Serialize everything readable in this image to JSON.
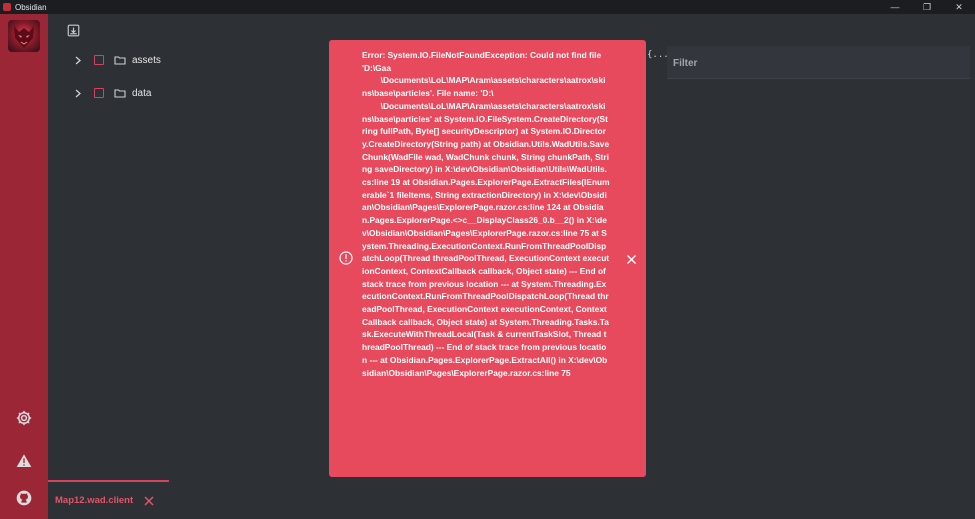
{
  "app": {
    "title": "Obsidian"
  },
  "window_controls": {
    "minimize": "—",
    "maximize": "❐",
    "close": "✕"
  },
  "tree": {
    "items": [
      {
        "label": "assets"
      },
      {
        "label": "data"
      }
    ]
  },
  "filter": {
    "placeholder": "Filter",
    "value": ""
  },
  "json_icon": "{...}",
  "tab": {
    "label": "Map12.wad.client"
  },
  "error": {
    "message": "Error: System.IO.FileNotFoundException: Could not find file 'D:\\Gaa\n        \\Documents\\LoL\\MAP\\Aram\\assets\\characters\\aatrox\\skins\\base\\particles'. File name: 'D:\\\n        \\Documents\\LoL\\MAP\\Aram\\assets\\characters\\aatrox\\skins\\base\\particles' at System.IO.FileSystem.CreateDirectory(String fullPath, Byte[] securityDescriptor) at System.IO.Directory.CreateDirectory(String path) at Obsidian.Utils.WadUtils.SaveChunk(WadFile wad, WadChunk chunk, String chunkPath, String saveDirectory) in X:\\dev\\Obsidian\\Obsidian\\Utils\\WadUtils.cs:line 19 at Obsidian.Pages.ExplorerPage.ExtractFiles(IEnumerable`1 fileItems, String extractionDirectory) in X:\\dev\\Obsidian\\Obsidian\\Pages\\ExplorerPage.razor.cs:line 124 at Obsidian.Pages.ExplorerPage.<>c__DisplayClass26_0.b__2() in X:\\dev\\Obsidian\\Obsidian\\Pages\\ExplorerPage.razor.cs:line 75 at System.Threading.ExecutionContext.RunFromThreadPoolDispatchLoop(Thread threadPoolThread, ExecutionContext executionContext, ContextCallback callback, Object state) --- End of stack trace from previous location --- at System.Threading.ExecutionContext.RunFromThreadPoolDispatchLoop(Thread threadPoolThread, ExecutionContext executionContext, ContextCallback callback, Object state) at System.Threading.Tasks.Task.ExecuteWithThreadLocal(Task & currentTaskSlot, Thread threadPoolThread) --- End of stack trace from previous location --- at Obsidian.Pages.ExplorerPage.ExtractAll() in X:\\dev\\Obsidian\\Obsidian\\Pages\\ExplorerPage.razor.cs:line 75"
  },
  "colors": {
    "accent": "#d4435a",
    "sidebar": "#9b2736",
    "toast": "#e84a5d",
    "background": "#2d3035"
  },
  "icons": {
    "sidebar": [
      "settings-gear-icon",
      "warning-icon",
      "github-icon"
    ],
    "toolbar": "save-archive-icon"
  }
}
